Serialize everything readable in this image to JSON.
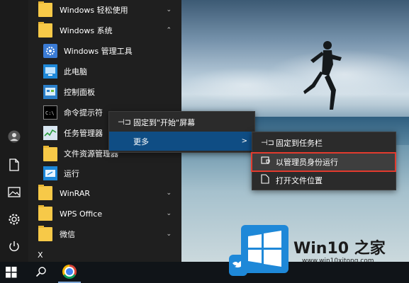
{
  "start_menu": {
    "items": [
      {
        "label": "Windows 轻松使用",
        "type": "folder",
        "chevron": "⌄"
      },
      {
        "label": "Windows 系统",
        "type": "folder",
        "chevron": "⌃"
      },
      {
        "label": "Windows 管理工具",
        "type": "app",
        "icon": "admin-tools-icon"
      },
      {
        "label": "此电脑",
        "type": "app",
        "icon": "this-pc-icon"
      },
      {
        "label": "控制面板",
        "type": "app",
        "icon": "control-panel-icon"
      },
      {
        "label": "命令提示符",
        "type": "app",
        "icon": "cmd-icon"
      },
      {
        "label": "任务管理器",
        "type": "app",
        "icon": "task-manager-icon"
      },
      {
        "label": "文件资源管理器",
        "type": "app",
        "icon": "file-explorer-icon"
      },
      {
        "label": "运行",
        "type": "app",
        "icon": "run-icon"
      },
      {
        "label": "WinRAR",
        "type": "folder",
        "chevron": "⌄"
      },
      {
        "label": "WPS Office",
        "type": "folder",
        "chevron": "⌄"
      },
      {
        "label": "微信",
        "type": "folder",
        "chevron": "⌄"
      }
    ],
    "section_letter": "X"
  },
  "context_menu": {
    "items": [
      {
        "label": "固定到\"开始\"屏幕",
        "icon": "pin-icon"
      },
      {
        "label": "更多",
        "arrow": ">"
      }
    ]
  },
  "submenu": {
    "items": [
      {
        "label": "固定到任务栏",
        "icon": "pin-icon"
      },
      {
        "label": "以管理员身份运行",
        "icon": "shield-icon"
      },
      {
        "label": "打开文件位置",
        "icon": "file-icon"
      }
    ]
  },
  "watermark": {
    "brand": "Win10 之家",
    "url": "www.win10xitong.com"
  },
  "colors": {
    "highlight_border": "#e23b2e",
    "selected_item": "#0f4d84",
    "watermark_blue": "#1e88d8"
  }
}
